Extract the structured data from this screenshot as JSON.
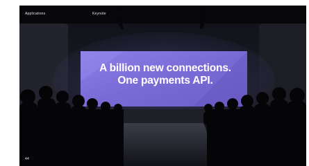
{
  "captions": {
    "top_left": "Applications",
    "top_center": "Keynote",
    "bottom_left": "44"
  },
  "screen": {
    "line1": "A billion new connections.",
    "line2": "One payments API."
  },
  "colors": {
    "screen": "#7f6fd8",
    "screen_highlight": "#9c8ff0",
    "room": "#14151c",
    "floor": "#2a2c36"
  }
}
